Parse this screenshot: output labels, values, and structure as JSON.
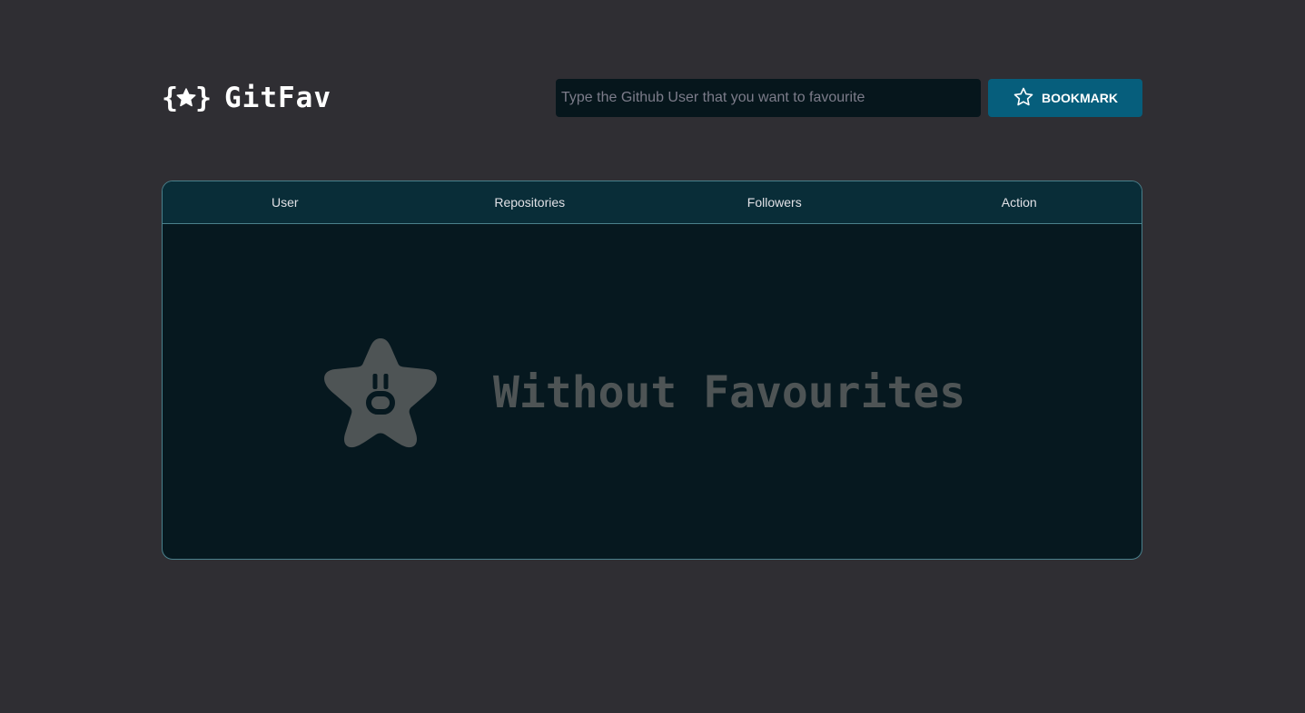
{
  "app": {
    "title": "GitFav"
  },
  "search": {
    "placeholder": "Type the Github User that you want to favourite",
    "value": ""
  },
  "bookmark_button": {
    "label": "BOOKMARK",
    "icon": "star-outline-icon"
  },
  "table": {
    "columns": [
      "User",
      "Repositories",
      "Followers",
      "Action"
    ],
    "rows": [],
    "empty_state": {
      "icon": "surprised-star-icon",
      "message": "Without Favourites"
    }
  },
  "colors": {
    "page_background": "#2f2e33",
    "accent": "#065e7c",
    "table_header": "#092d38",
    "table_body": "#06181f",
    "table_border": "#4a808c",
    "empty_state": "#4e5455"
  }
}
